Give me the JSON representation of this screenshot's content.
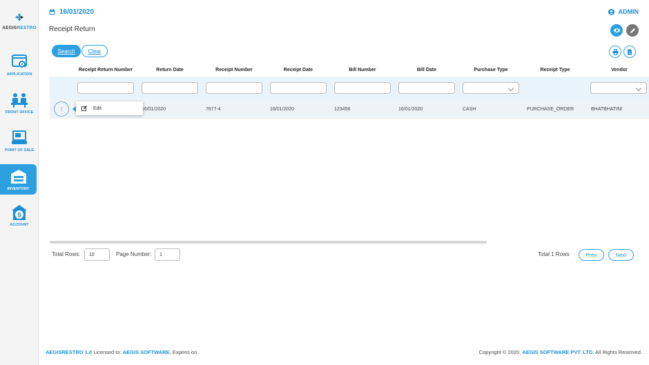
{
  "app": {
    "logo_prefix": "AEGIS",
    "logo_suffix": "RESTRO"
  },
  "sidebar": {
    "items": [
      {
        "label": "APPLICATION",
        "icon": "application-icon",
        "active": false
      },
      {
        "label": "FRONT OFFICE",
        "icon": "front-office-icon",
        "active": false
      },
      {
        "label": "POINT OF SALE",
        "icon": "point-of-sale-icon",
        "active": false
      },
      {
        "label": "INVENTORY",
        "icon": "inventory-icon",
        "active": true
      },
      {
        "label": "ACCOUNT",
        "icon": "account-icon",
        "active": false
      }
    ]
  },
  "header": {
    "date": "16/01/2020",
    "user": "ADMIN",
    "title": "Receipt Return"
  },
  "toolbar": {
    "search_label": "Search",
    "clear_label": "Clear"
  },
  "table": {
    "columns": [
      "Receipt Return Number",
      "Return Date",
      "Receipt Number",
      "Receipt Date",
      "Bill Number",
      "Bill Date",
      "Purchase Type",
      "Receipt Type",
      "Vendor"
    ],
    "rows": [
      {
        "action": "⋮",
        "receipt_return_number": "",
        "return_date": "16/01/2020",
        "receipt_number": "7677-4",
        "receipt_date": "16/01/2020",
        "bill_number": "123456",
        "bill_date": "16/01/2020",
        "purchase_type": "CASH",
        "receipt_type": "PURCHASE_ORDER",
        "vendor": "BHATBHATINI"
      }
    ]
  },
  "context_menu": {
    "edit_label": "Edit"
  },
  "pager": {
    "total_rows_label": "Total Rows:",
    "total_rows_value": "10",
    "page_number_label": "Page Number:",
    "page_number_value": "1",
    "total_count": "Total 1 Rows",
    "prev_label": "Prev",
    "next_label": "Next"
  },
  "footer": {
    "product": "AEGISRESTRO 1.0",
    "licensed_text": " Licensed to: ",
    "licensee": "AEGIS SOFTWARE",
    "expires_text": ", Expires on .",
    "copyright_prefix": "Copyright © 2020, ",
    "company": "AEGIS SOFTWARE PVT. LTD.",
    "rights": " All Rights Reserved."
  },
  "colors": {
    "accent": "#2b9fe0",
    "accent_text": "#1a8fd6",
    "row_bg": "#eef3f8",
    "filter_bg": "#e9f3fb"
  }
}
